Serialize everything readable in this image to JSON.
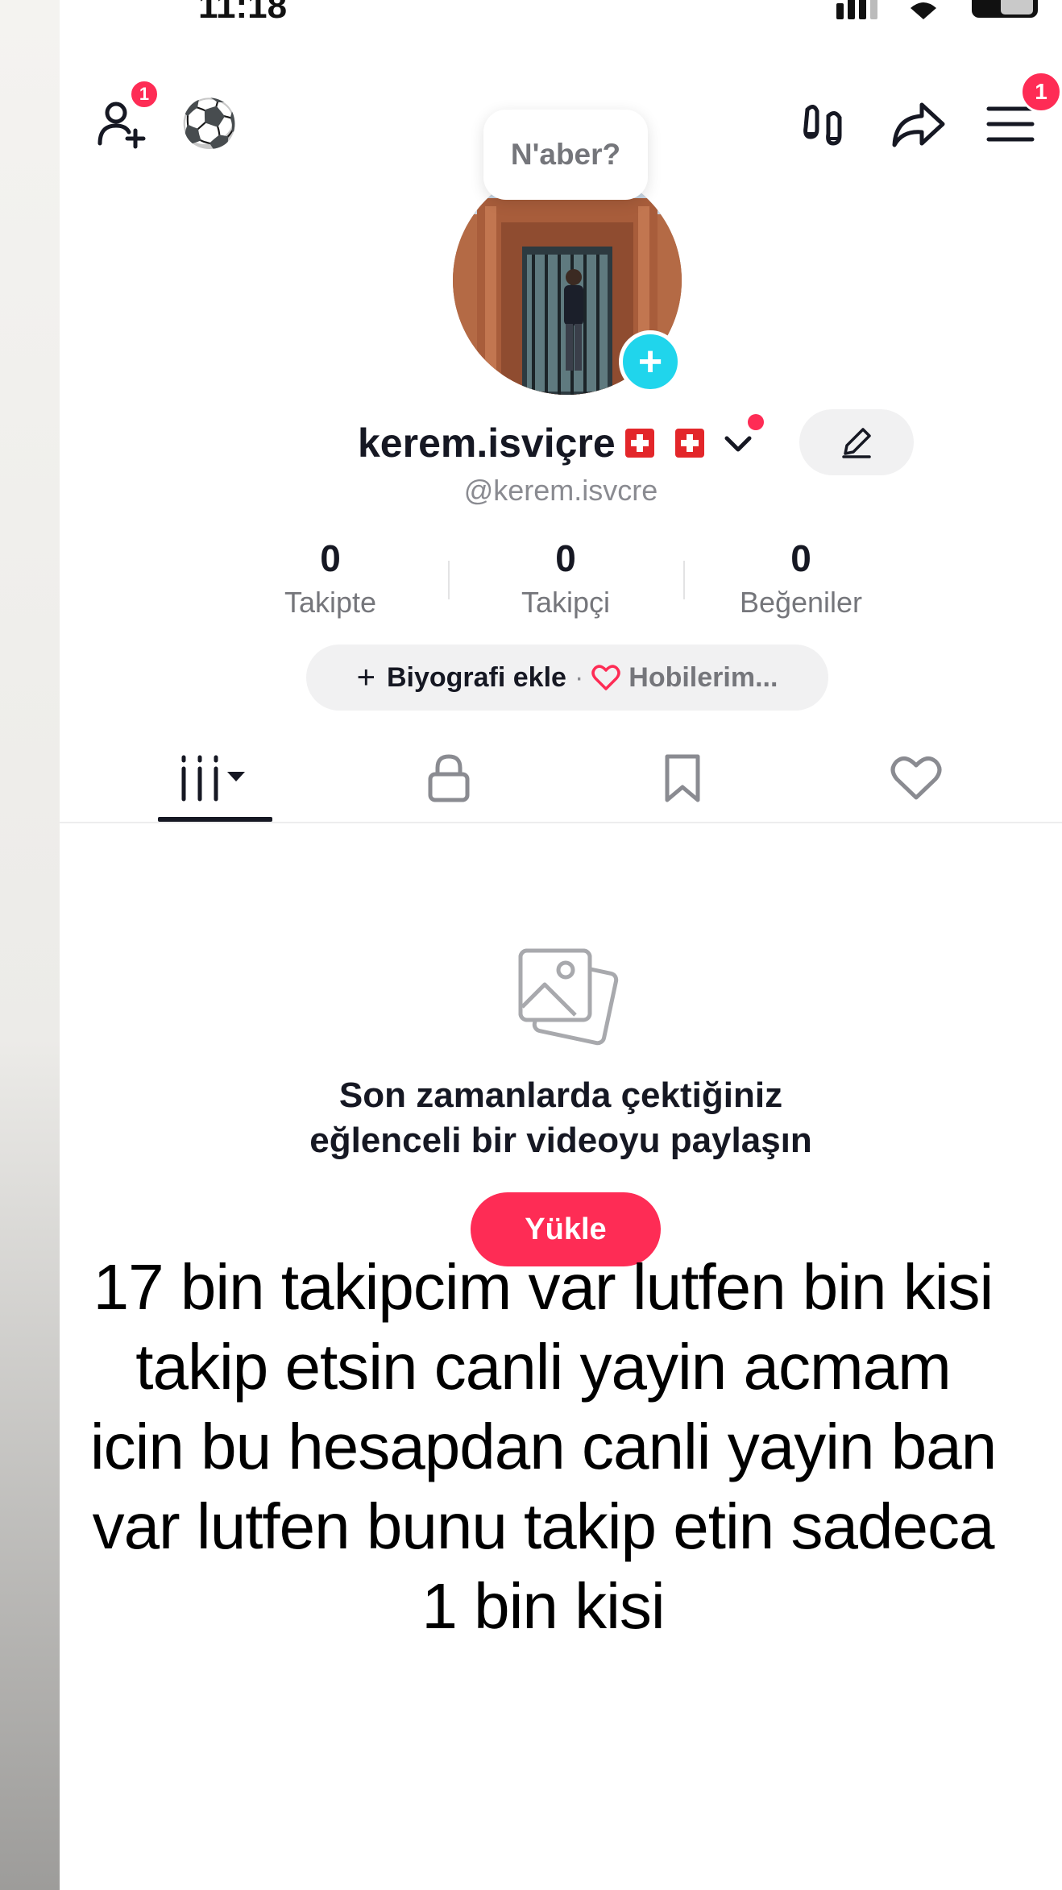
{
  "status_bar": {
    "time": "11:18"
  },
  "header": {
    "add_friends_badge": "1",
    "emoji": "⚽",
    "menu_badge": "1"
  },
  "profile": {
    "speech_bubble": "N'aber?",
    "username": "kerem.isviçre",
    "handle": "@kerem.isvcre"
  },
  "stats": [
    {
      "value": "0",
      "label": "Takipte"
    },
    {
      "value": "0",
      "label": "Takipçi"
    },
    {
      "value": "0",
      "label": "Beğeniler"
    }
  ],
  "bio": {
    "add_label": "Biyografi ekle",
    "separator": "·",
    "hobbies_label": "Hobilerim..."
  },
  "tabs": [
    {
      "name": "videos",
      "icon": "grid-icon",
      "active": true
    },
    {
      "name": "private",
      "icon": "lock-icon",
      "active": false
    },
    {
      "name": "saved",
      "icon": "bookmark-icon",
      "active": false
    },
    {
      "name": "liked",
      "icon": "heart-icon",
      "active": false
    }
  ],
  "empty_state": {
    "line1": "Son zamanlarda çektiğiniz",
    "line2": "eğlenceli bir videoyu paylaşın",
    "button": "Yükle"
  },
  "overlay_caption": "17 bin takipcim var lutfen bin kisi takip etsin canli yayin acmam icin bu hesapdan canli yayin ban var lutfen bunu takip etin sadeca 1 bin kisi",
  "colors": {
    "accent": "#fe2c55",
    "avatar_plus": "#20d5ec",
    "text_primary": "#161823",
    "text_secondary": "#75767b"
  }
}
